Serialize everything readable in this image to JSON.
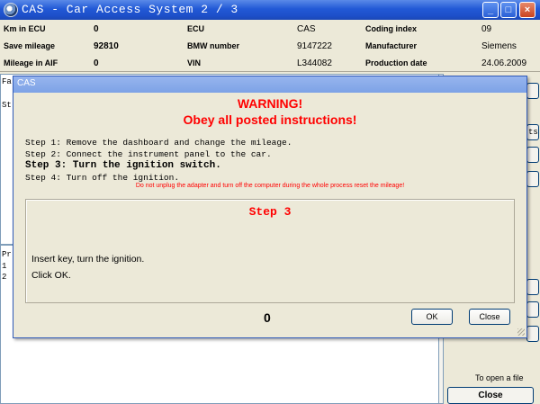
{
  "window": {
    "title": "CAS - Car Access System 2 / 3",
    "min_glyph": "_",
    "max_glyph": "□",
    "close_glyph": "×"
  },
  "info": {
    "km_in_ecu_label": "Km in ECU",
    "km_in_ecu_value": "0",
    "save_mileage_label": "Save mileage",
    "save_mileage_value": "92810",
    "mileage_aif_label": "Mileage in AIF",
    "mileage_aif_value": "0",
    "ecu_label": "ECU",
    "ecu_value": "CAS",
    "bmw_number_label": "BMW number",
    "bmw_number_value": "9147222",
    "vin_label": "VIN",
    "vin_value": "L344082",
    "coding_index_label": "Coding index",
    "coding_index_value": "09",
    "manufacturer_label": "Manufacturer",
    "manufacturer_value": "Siemens",
    "production_date_label": "Production date",
    "production_date_value": "24.06.2009"
  },
  "background": {
    "fa_frag": "Fa",
    "st_frag": "St",
    "pr_frag": "Pr",
    "line1": "1",
    "line2": "2",
    "side_frag": "ts",
    "open_file_label": "To open a file",
    "close_label": "Close"
  },
  "dialog": {
    "title": "CAS",
    "warning": "WARNING!",
    "subtitle": "Obey all posted instructions!",
    "steps": [
      "Step 1: Remove the dashboard and change the mileage.",
      "Step 2: Connect the instrument panel to the car.",
      "Step 3: Turn the ignition switch.",
      "Step 4: Turn off the ignition."
    ],
    "note": "Do not unplug the adapter and turn off the computer during the whole process reset the mileage!",
    "step_heading": "Step 3",
    "instruction1": "Insert key, turn the ignition.",
    "instruction2": "Click OK.",
    "counter": "0",
    "ok_label": "OK",
    "cancel_label": "Close"
  },
  "colors": {
    "titlebar": "#2259d6",
    "warning": "#ff0000",
    "dialog_title": "#7da2e6",
    "background": "#ece9d8"
  }
}
